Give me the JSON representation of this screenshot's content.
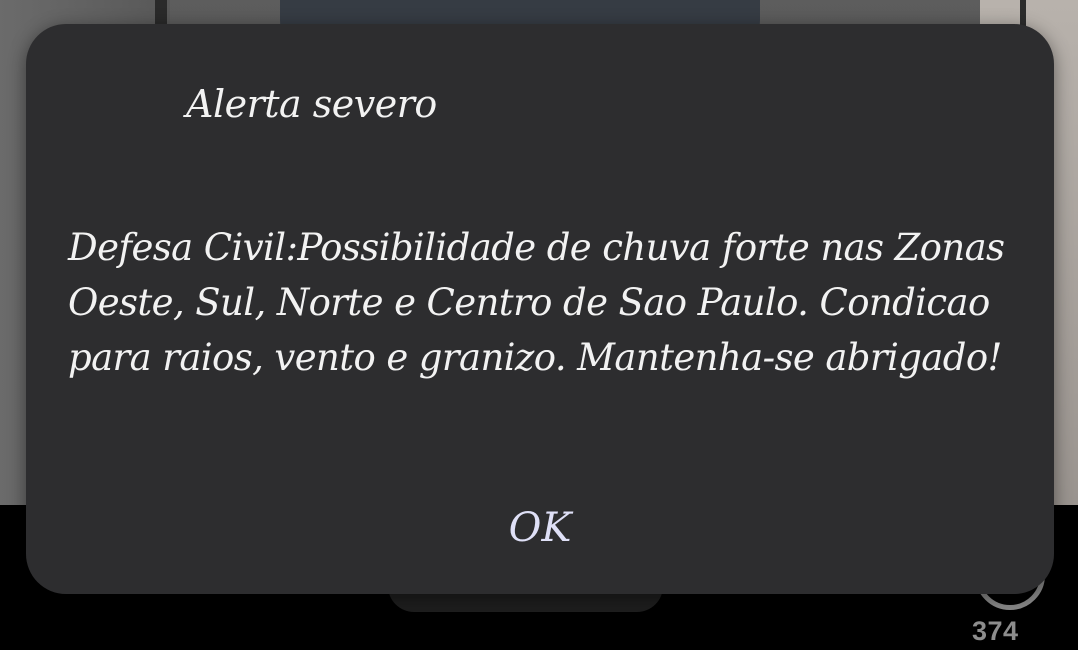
{
  "dialog": {
    "title": "Alerta severo",
    "message": "Defesa Civil:Possibilidade de chuva forte nas Zonas Oeste, Sul, Norte e Centro de Sao Paulo. Condicao para raios, vento e granizo. Mantenha-se abrigado!",
    "ok_label": "OK"
  },
  "background": {
    "comment_count": "374"
  },
  "colors": {
    "dialog_background": "#2d2d2f",
    "dialog_text": "#f2f2f2",
    "ok_text": "#dfe0f7",
    "screen_background": "#000000",
    "count_text": "#8d8d8d"
  },
  "icons": {
    "comment": "comment-bubble-icon"
  }
}
